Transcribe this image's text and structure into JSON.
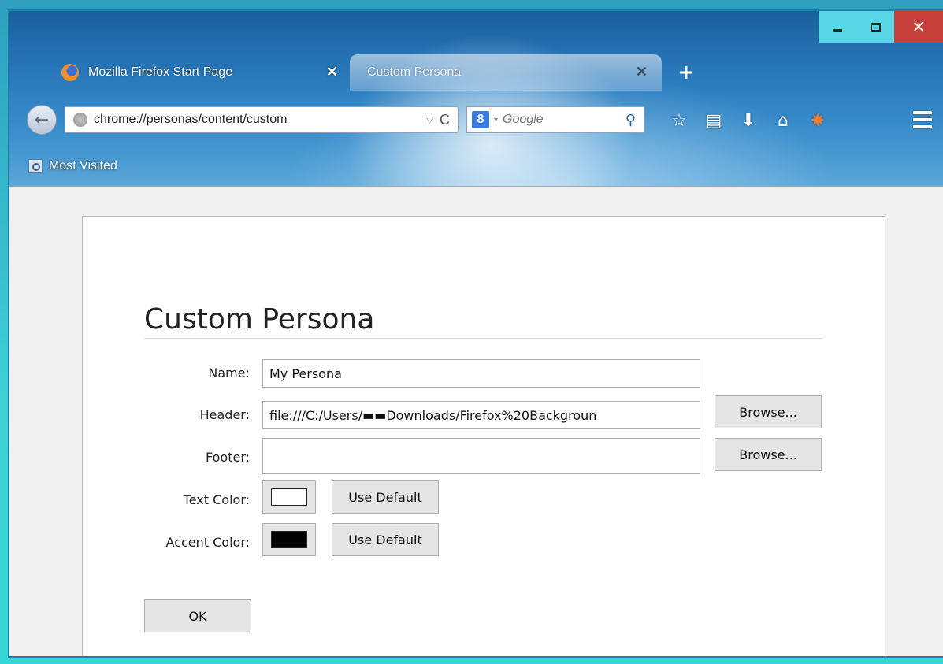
{
  "window": {
    "caption": {
      "minimize": "–",
      "maximize": "",
      "close": "✕"
    },
    "tabs": [
      {
        "label": "Mozilla Firefox Start Page",
        "close": "✕",
        "icon": "firefox-icon"
      },
      {
        "label": "Custom Persona",
        "close": "✕",
        "active": true
      }
    ],
    "new_tab": "+"
  },
  "navbar": {
    "back": "←",
    "url": "chrome://personas/content/custom",
    "url_dropdown": "▽",
    "reload": "C",
    "search_engine": "8",
    "search_dropdown": "▾",
    "search_placeholder": "Google",
    "search_icon": "⚲",
    "icons": [
      "bookmark-star-icon",
      "reading-list-icon",
      "downloads-icon",
      "home-icon",
      "persona-icon",
      "menu-icon"
    ],
    "icon_glyphs": {
      "star": "☆",
      "list": "▤",
      "download": "⬇",
      "home": "⌂",
      "persona": "✸"
    }
  },
  "bookmarks": {
    "most_visited": "Most Visited"
  },
  "form": {
    "title": "Custom Persona",
    "name_label": "Name:",
    "name_value": "My Persona",
    "header_label": "Header:",
    "header_value": "file:///C:/Users/▬▬Downloads/Firefox%20Backgroun",
    "header_browse": "Browse...",
    "footer_label": "Footer:",
    "footer_value": "",
    "footer_browse": "Browse...",
    "text_color_label": "Text Color:",
    "text_color": "#ffffff",
    "text_color_default": "Use Default",
    "accent_color_label": "Accent Color:",
    "accent_color": "#000000",
    "accent_color_default": "Use Default",
    "ok": "OK"
  }
}
